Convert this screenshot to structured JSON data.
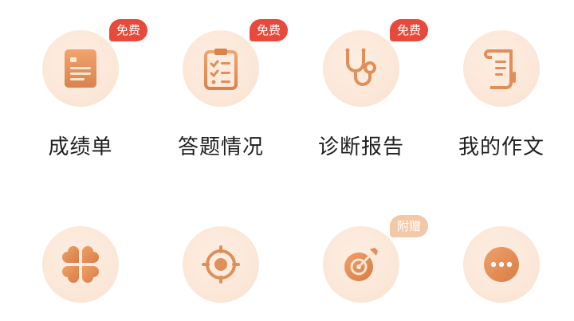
{
  "colors": {
    "accent": "#e8935b",
    "badge_red": "#e74a3b",
    "badge_tan": "#f2c9a8",
    "circle_bg": "#fbe6d6"
  },
  "row1": [
    {
      "label": "成绩单",
      "badge": "免费",
      "icon": "report-card-icon"
    },
    {
      "label": "答题情况",
      "badge": "免费",
      "icon": "clipboard-checklist-icon"
    },
    {
      "label": "诊断报告",
      "badge": "免费",
      "icon": "stethoscope-icon"
    },
    {
      "label": "我的作文",
      "badge": "",
      "icon": "scroll-essay-icon"
    }
  ],
  "row2": [
    {
      "badge": "",
      "icon": "clover-grid-icon"
    },
    {
      "badge": "",
      "icon": "target-icon"
    },
    {
      "badge": "附赠",
      "icon": "dart-target-icon"
    },
    {
      "badge": "",
      "icon": "more-icon"
    }
  ]
}
